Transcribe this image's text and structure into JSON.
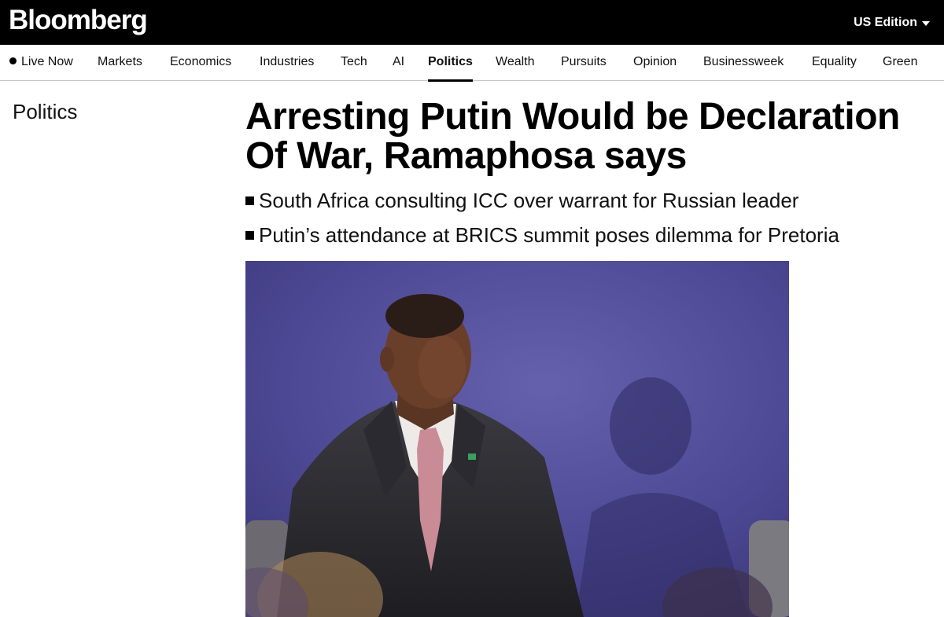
{
  "header": {
    "logo": "Bloomberg",
    "edition": "US Edition"
  },
  "nav": {
    "items": [
      {
        "label": "Live Now",
        "live": true
      },
      {
        "label": "Markets"
      },
      {
        "label": "Economics"
      },
      {
        "label": "Industries"
      },
      {
        "label": "Tech"
      },
      {
        "label": "AI"
      },
      {
        "label": "Politics",
        "active": true
      },
      {
        "label": "Wealth"
      },
      {
        "label": "Pursuits"
      },
      {
        "label": "Opinion"
      },
      {
        "label": "Businessweek"
      },
      {
        "label": "Equality"
      },
      {
        "label": "Green"
      }
    ]
  },
  "article": {
    "section": "Politics",
    "headline": "Arresting Putin Would be Declaration Of War, Ramaphosa says",
    "bullets": [
      "South Africa consulting ICC over warrant for Russian leader",
      "Putin’s attendance at BRICS summit poses dilemma for Pretoria"
    ]
  },
  "colors": {
    "topbar": "#000000",
    "photo_backdrop": "#4f4a98"
  }
}
